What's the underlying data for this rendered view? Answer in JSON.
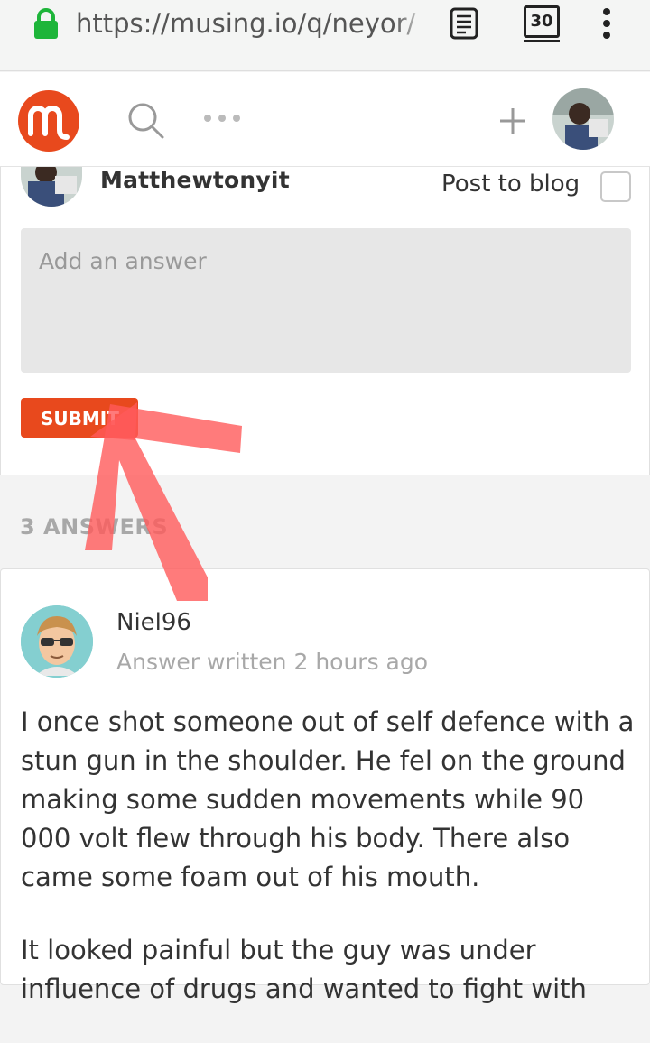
{
  "browser": {
    "url": "https://musing.io/q/neyor/",
    "tab_count": "30"
  },
  "header": {
    "logo_icon": "musing-logo-icon",
    "search_icon": "search-icon",
    "more_icon": "more-dots-icon",
    "add_icon": "plus-icon",
    "brand_color": "#e8491d"
  },
  "composer": {
    "username": "Matthewtonyit",
    "post_to_blog_label": "Post to blog",
    "answer_placeholder": "Add an answer",
    "submit_label": "SUBMIT"
  },
  "answers": {
    "count_label": "3 ANSWERS",
    "items": [
      {
        "username": "Niel96",
        "meta": "Answer written 2 hours ago",
        "paragraphs": [
          "I once shot someone out of self defence with a stun gun in the shoulder. He fel on the ground making some sudden movements while 90 000 volt flew through his body. There also came some foam out of his mouth.",
          "It looked painful but the guy was under influence of drugs and wanted to fight with"
        ]
      }
    ]
  }
}
